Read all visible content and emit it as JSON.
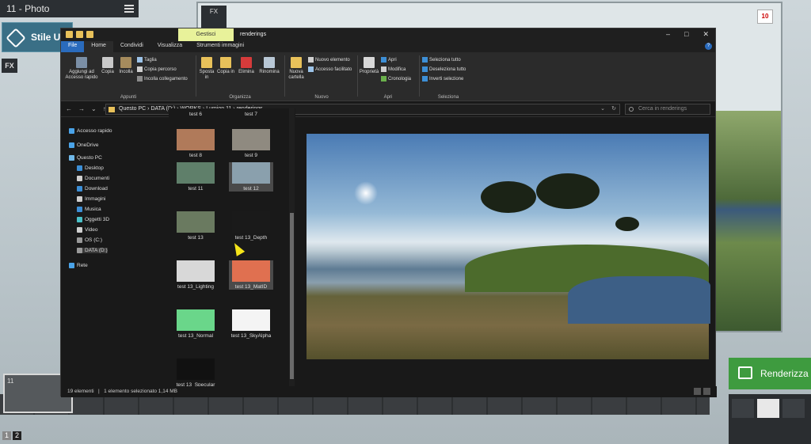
{
  "lumion": {
    "title": "11 - Photo",
    "style_label": "Stile U",
    "fx_small": "FX",
    "fx_big": "FX",
    "badge": "10",
    "render_label": "Renderizza",
    "film_first_label": "11",
    "pages": [
      "1",
      "2"
    ]
  },
  "explorer": {
    "context_tab": "Gestisci",
    "window_title": "renderings",
    "controls": [
      "–",
      "□",
      "✕"
    ],
    "tabs": [
      "File",
      "Home",
      "Condividi",
      "Visualizza",
      "Strumenti immagini"
    ],
    "ribbon": {
      "pin_label": "Aggiungi ad Accesso rapido",
      "copy_label": "Copia",
      "paste_label": "Incolla",
      "cut_label": "Taglia",
      "copy_path_label": "Copia percorso",
      "paste_link_label": "Incolla collegamento",
      "group_clipboard": "Appunti",
      "move_label": "Sposta in",
      "copyto_label": "Copia in",
      "delete_label": "Elimina",
      "rename_label": "Rinomina",
      "group_organize": "Organizza",
      "new_folder_label": "Nuova cartella",
      "new_item_label": "Nuovo elemento",
      "easy_access_label": "Accesso facilitato",
      "group_new": "Nuovo",
      "properties_label": "Proprietà",
      "open_label": "Apri",
      "edit_label": "Modifica",
      "history_label": "Cronologia",
      "group_open": "Apri",
      "select_all_label": "Seleziona tutto",
      "select_none_label": "Deseleziona tutto",
      "invert_label": "Inverti selezione",
      "group_select": "Seleziona"
    },
    "address": {
      "path": "Questo PC  ›  DATA (D:)  ›  WORKS  ›  Lumion 11  ›  renderings",
      "search_placeholder": "Cerca in renderings"
    },
    "nav": [
      {
        "label": "Accesso rapido",
        "color": "#4aa3e8"
      },
      {
        "label": "OneDrive",
        "color": "#4aa3e8"
      },
      {
        "label": "Questo PC",
        "color": "#6fb7e8"
      },
      {
        "label": "Desktop",
        "color": "#3d8fd6"
      },
      {
        "label": "Documenti",
        "color": "#cfcfcf"
      },
      {
        "label": "Download",
        "color": "#3d8fd6"
      },
      {
        "label": "Immagini",
        "color": "#cfcfcf"
      },
      {
        "label": "Musica",
        "color": "#3d8fd6"
      },
      {
        "label": "Oggetti 3D",
        "color": "#4ac0c8"
      },
      {
        "label": "Video",
        "color": "#cfcfcf"
      },
      {
        "label": "OS (C:)",
        "color": "#999"
      },
      {
        "label": "DATA (D:)",
        "color": "#999"
      },
      {
        "label": "Rete",
        "color": "#4aa3e8"
      }
    ],
    "files": [
      {
        "name": "test 6",
        "color": ""
      },
      {
        "name": "test 7",
        "color": ""
      },
      {
        "name": "test 8",
        "color": "#b07a5a"
      },
      {
        "name": "test 9",
        "color": "#8f8a80"
      },
      {
        "name": "test 11",
        "color": "#5f7f6a"
      },
      {
        "name": "test 12",
        "color": "#8aa0ad"
      },
      {
        "name": "test 13",
        "color": "#6a7a60"
      },
      {
        "name": "test 13_Depth",
        "color": "#1a1a1a"
      },
      {
        "name": "test 13_Lighting",
        "color": "#d8d8d8"
      },
      {
        "name": "test 13_MatID",
        "color": "#e07050"
      },
      {
        "name": "test 13_Normal",
        "color": "#6ad68a"
      },
      {
        "name": "test 13_SkyAlpha",
        "color": "#f4f4f4"
      },
      {
        "name": "test 13_Specular",
        "color": "#111111"
      }
    ],
    "status": {
      "count": "19 elementi",
      "selected": "1 elemento selezionato  1,14 MB"
    }
  }
}
